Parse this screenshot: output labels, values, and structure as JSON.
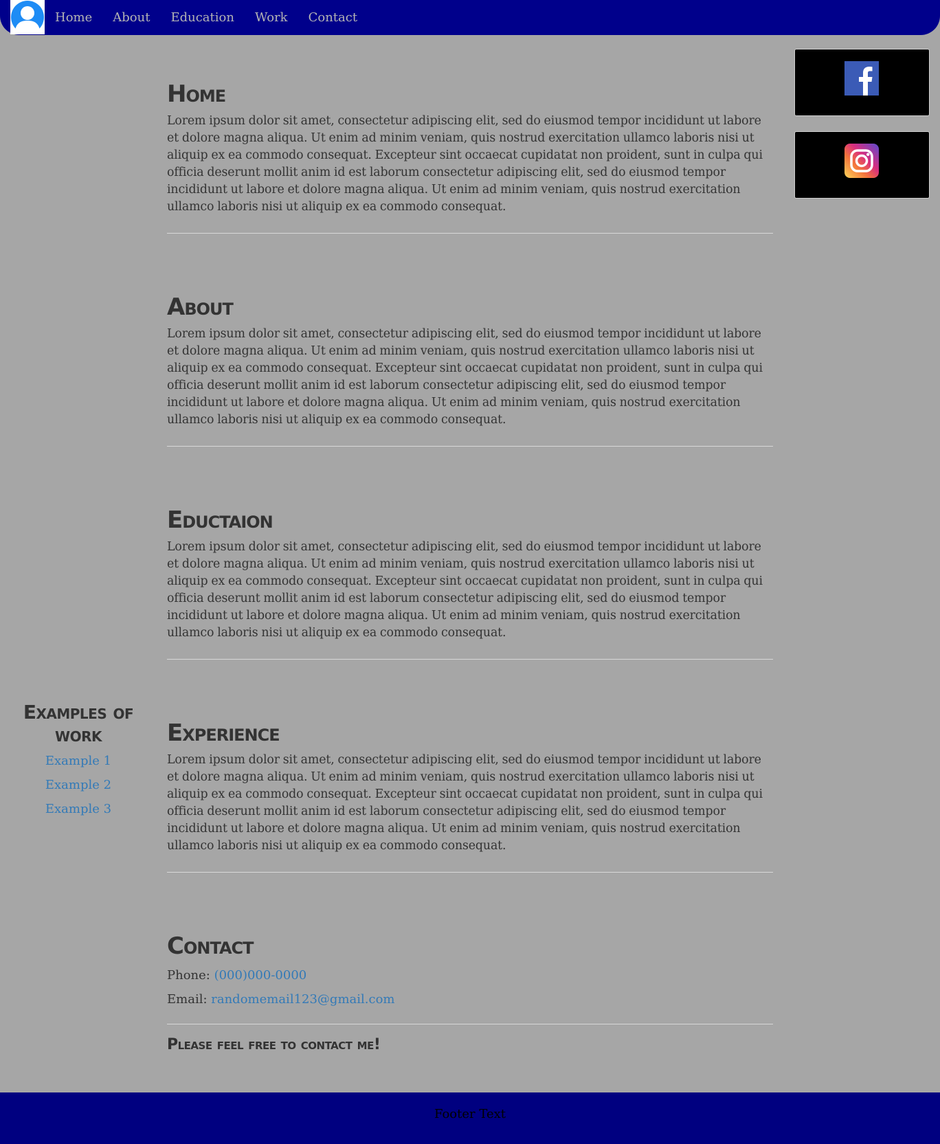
{
  "nav": {
    "items": [
      {
        "label": "Home"
      },
      {
        "label": "About"
      },
      {
        "label": "Education"
      },
      {
        "label": "Work"
      },
      {
        "label": "Contact"
      }
    ]
  },
  "social": {
    "facebook_icon": "facebook-icon",
    "instagram_icon": "instagram-icon"
  },
  "sections": {
    "home": {
      "title": "Home",
      "text": "Lorem ipsum dolor sit amet, consectetur adipiscing elit, sed do eiusmod tempor incididunt ut labore et dolore magna aliqua. Ut enim ad minim veniam, quis nostrud exercitation ullamco laboris nisi ut aliquip ex ea commodo consequat. Excepteur sint occaecat cupidatat non proident, sunt in culpa qui officia deserunt mollit anim id est laborum consectetur adipiscing elit, sed do eiusmod tempor incididunt ut labore et dolore magna aliqua. Ut enim ad minim veniam, quis nostrud exercitation ullamco laboris nisi ut aliquip ex ea commodo consequat."
    },
    "about": {
      "title": "About",
      "text": "Lorem ipsum dolor sit amet, consectetur adipiscing elit, sed do eiusmod tempor incididunt ut labore et dolore magna aliqua. Ut enim ad minim veniam, quis nostrud exercitation ullamco laboris nisi ut aliquip ex ea commodo consequat. Excepteur sint occaecat cupidatat non proident, sunt in culpa qui officia deserunt mollit anim id est laborum consectetur adipiscing elit, sed do eiusmod tempor incididunt ut labore et dolore magna aliqua. Ut enim ad minim veniam, quis nostrud exercitation ullamco laboris nisi ut aliquip ex ea commodo consequat."
    },
    "education": {
      "title": "Eductaion",
      "text": "Lorem ipsum dolor sit amet, consectetur adipiscing elit, sed do eiusmod tempor incididunt ut labore et dolore magna aliqua. Ut enim ad minim veniam, quis nostrud exercitation ullamco laboris nisi ut aliquip ex ea commodo consequat. Excepteur sint occaecat cupidatat non proident, sunt in culpa qui officia deserunt mollit anim id est laborum consectetur adipiscing elit, sed do eiusmod tempor incididunt ut labore et dolore magna aliqua. Ut enim ad minim veniam, quis nostrud exercitation ullamco laboris nisi ut aliquip ex ea commodo consequat."
    },
    "experience": {
      "title": "Experience",
      "text": "Lorem ipsum dolor sit amet, consectetur adipiscing elit, sed do eiusmod tempor incididunt ut labore et dolore magna aliqua. Ut enim ad minim veniam, quis nostrud exercitation ullamco laboris nisi ut aliquip ex ea commodo consequat. Excepteur sint occaecat cupidatat non proident, sunt in culpa qui officia deserunt mollit anim id est laborum consectetur adipiscing elit, sed do eiusmod tempor incididunt ut labore et dolore magna aliqua. Ut enim ad minim veniam, quis nostrud exercitation ullamco laboris nisi ut aliquip ex ea commodo consequat."
    },
    "contact": {
      "title": "Contact",
      "phone_label": "Phone: ",
      "phone_value": "(000)000-0000",
      "email_label": "Email: ",
      "email_value": "randomemail123@gmail.com",
      "cta": "Please feel free to contact me!"
    }
  },
  "sidebar": {
    "title": "Examples of work",
    "links": [
      {
        "label": "Example 1"
      },
      {
        "label": "Example 2"
      },
      {
        "label": "Example 3"
      }
    ]
  },
  "footer": {
    "text": "Footer Text"
  },
  "colors": {
    "navbar": "#00008b",
    "footer": "#000080",
    "background": "#a6a6a6",
    "link": "#337ab7",
    "text": "#333333"
  }
}
